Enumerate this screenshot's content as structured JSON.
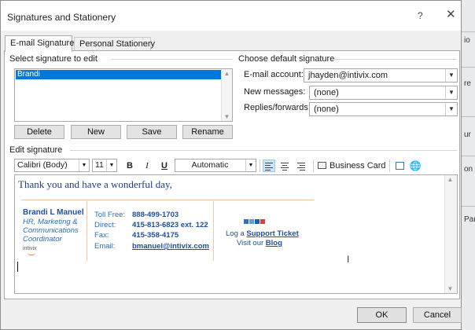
{
  "window": {
    "title": "Signatures and Stationery",
    "help_label": "?",
    "close_label": "✕"
  },
  "tabs": [
    {
      "label": "E-mail Signature",
      "active": true
    },
    {
      "label": "Personal Stationery",
      "active": false
    }
  ],
  "select_signature": {
    "group_label": "Select signature to edit",
    "items": [
      "Brandi"
    ],
    "selected": "Brandi"
  },
  "signature_buttons": {
    "delete": "Delete",
    "new": "New",
    "save": "Save",
    "rename": "Rename"
  },
  "default_signature": {
    "group_label": "Choose default signature",
    "email_account_label": "E-mail account:",
    "email_account_value": "jhayden@intivix.com",
    "new_messages_label": "New messages:",
    "new_messages_value": "(none)",
    "replies_label": "Replies/forwards:",
    "replies_value": "(none)"
  },
  "edit_signature": {
    "group_label": "Edit signature",
    "font_name": "Calibri (Body)",
    "font_size": "11",
    "bold": "B",
    "italic": "I",
    "underline": "U",
    "color": "Automatic",
    "business_card": "Business Card"
  },
  "signature_body": {
    "greeting": "Thank you and have a wonderful day,",
    "name": "Brandi L Manuel",
    "title_lines": [
      "HR, Marketing &",
      "Communications",
      "Coordinator"
    ],
    "logo_text": "intivix",
    "contacts": [
      {
        "label": "Toll Free:",
        "value": "888-499-1703"
      },
      {
        "label": "Direct:",
        "value": "415-813-6823 ext. 122"
      },
      {
        "label": "Fax:",
        "value": "415-358-4175"
      },
      {
        "label": "Email:",
        "value": "bmanuel@intivix.com"
      }
    ],
    "log_prefix": "Log a ",
    "support_link": "Support Ticket",
    "visit_prefix": "Visit our ",
    "blog_link": "Blog"
  },
  "footer": {
    "ok": "OK",
    "cancel": "Cancel"
  },
  "backdrop": {
    "fragments": [
      "io",
      "re",
      "ur",
      "on",
      "Par"
    ]
  }
}
